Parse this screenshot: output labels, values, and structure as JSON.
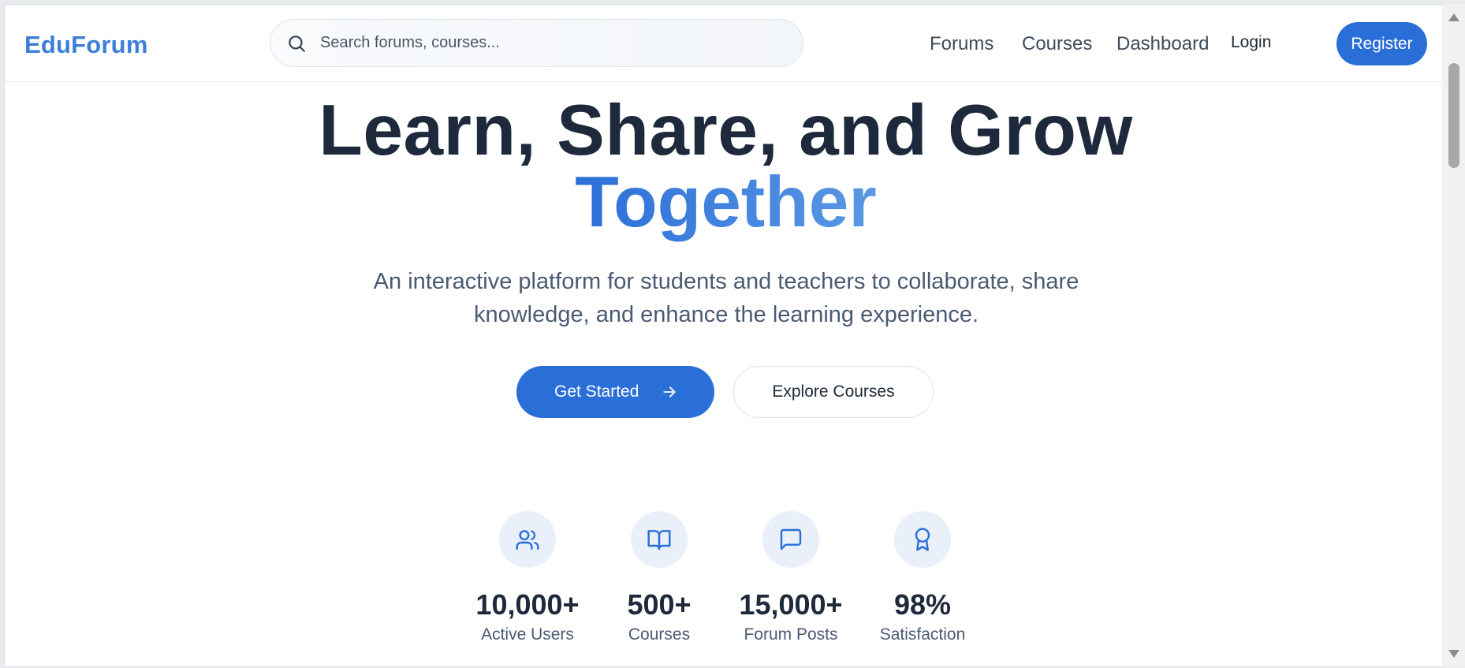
{
  "header": {
    "logo": "EduForum",
    "search": {
      "placeholder": "Search forums, courses...",
      "value": ""
    },
    "nav": [
      "Forums",
      "Courses",
      "Dashboard"
    ],
    "login_label": "Login",
    "register_label": "Register"
  },
  "hero": {
    "title_line1": "Learn, Share, and Grow",
    "title_line2": "Together",
    "subtitle": "An interactive platform for students and teachers to collaborate, share knowledge, and enhance the learning experience.",
    "primary_button": "Get Started",
    "secondary_button": "Explore Courses"
  },
  "stats": [
    {
      "icon": "users-icon",
      "value": "10,000+",
      "label": "Active Users"
    },
    {
      "icon": "book-icon",
      "value": "500+",
      "label": "Courses"
    },
    {
      "icon": "message-icon",
      "value": "15,000+",
      "label": "Forum Posts"
    },
    {
      "icon": "award-icon",
      "value": "98%",
      "label": "Satisfaction"
    }
  ],
  "colors": {
    "primary": "#2a6fd8",
    "logo": "#3b7fd8",
    "heading": "#1e293b",
    "muted": "#4a5a73",
    "icon_bg": "#e9f0fa"
  }
}
